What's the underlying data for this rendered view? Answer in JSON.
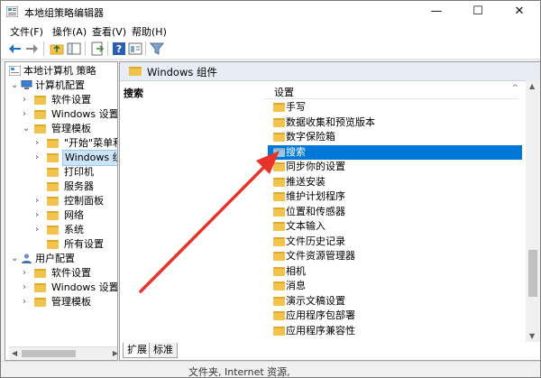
{
  "window": {
    "title": "本地组策略编辑器",
    "minimize_glyph": "—",
    "maximize_glyph": "☐",
    "close_glyph": "✕"
  },
  "menu": [
    "文件(F)",
    "操作(A)",
    "查看(V)",
    "帮助(H)"
  ],
  "toolbar": {
    "icons": [
      "back-icon",
      "forward-icon",
      "up-folder-icon",
      "show-hide-tree-icon",
      "export-list-icon",
      "help-icon",
      "properties-icon",
      "filter-icon"
    ]
  },
  "tree": {
    "root": "本地计算机 策略",
    "computer_config": "计算机配置",
    "items": [
      "软件设置",
      "Windows 设置",
      "管理模板",
      "\"开始\"菜单和",
      "Windows 组",
      "打印机",
      "服务器",
      "控制面板",
      "网络",
      "系统",
      "所有设置"
    ],
    "user_config": "用户配置",
    "user_items": [
      "软件设置",
      "Windows 设置",
      "管理模板"
    ]
  },
  "right": {
    "header": "Windows 组件",
    "description_title": "搜索",
    "column_header": "设置",
    "items": [
      "手写",
      "数据收集和预览版本",
      "数字保险箱",
      "搜索",
      "同步你的设置",
      "推送安装",
      "维护计划程序",
      "位置和传感器",
      "文本输入",
      "文件历史记录",
      "文件资源管理器",
      "相机",
      "消息",
      "演示文稿设置",
      "应用程序包部署",
      "应用程序兼容性"
    ],
    "selected_item": "搜索"
  },
  "tabs": [
    "扩展",
    "标准"
  ],
  "status": "文件夹, Internet 资源,",
  "colors": {
    "selection_blue": "#0078d7",
    "folder_yellow": "#f1c34c",
    "arrow_red": "#e8332a"
  }
}
